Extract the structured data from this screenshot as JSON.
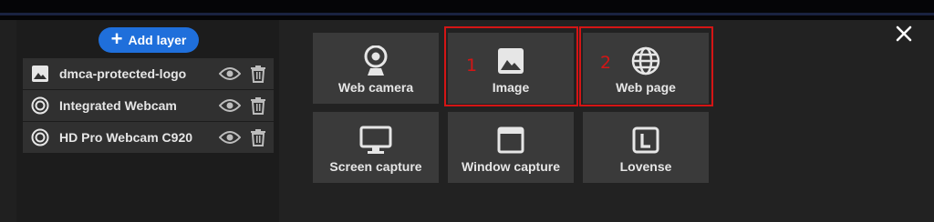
{
  "header": {
    "add_layer_label": "Add layer",
    "close_icon": "close-icon"
  },
  "layers": [
    {
      "label": "dmca-protected-logo",
      "icon": "image-icon"
    },
    {
      "label": "Integrated Webcam",
      "icon": "webcam-ring-icon"
    },
    {
      "label": "HD Pro Webcam C920",
      "icon": "webcam-ring-icon"
    }
  ],
  "sources": [
    {
      "label": "Web camera",
      "icon": "webcam-icon"
    },
    {
      "label": "Image",
      "icon": "image-icon"
    },
    {
      "label": "Web page",
      "icon": "globe-icon"
    },
    {
      "label": "Screen capture",
      "icon": "monitor-icon"
    },
    {
      "label": "Window capture",
      "icon": "window-icon"
    },
    {
      "label": "Lovense",
      "icon": "lovense-icon"
    }
  ],
  "annotations": [
    "1",
    "2"
  ],
  "colors": {
    "accent": "#1f6fdb",
    "highlight": "#d41515",
    "tile": "#3a3a3a"
  }
}
